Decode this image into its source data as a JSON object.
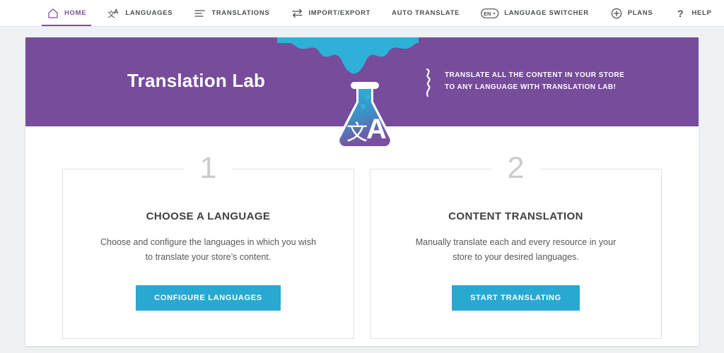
{
  "nav": {
    "items": [
      {
        "label": "HOME",
        "icon": "home-icon",
        "active": true
      },
      {
        "label": "LANGUAGES",
        "icon": "translate-icon",
        "active": false
      },
      {
        "label": "TRANSLATIONS",
        "icon": "list-lines-icon",
        "active": false
      },
      {
        "label": "IMPORT/EXPORT",
        "icon": "exchange-arrows-icon",
        "active": false
      },
      {
        "label": "AUTO TRANSLATE",
        "icon": "none",
        "active": false
      },
      {
        "label": "LANGUAGE SWITCHER",
        "icon": "en-dropdown-badge-icon",
        "active": false
      },
      {
        "label": "PLANS",
        "icon": "plus-circle-icon",
        "active": false
      },
      {
        "label": "HELP",
        "icon": "question-mark-icon",
        "active": false
      }
    ],
    "badge_text": "EN"
  },
  "banner": {
    "title": "Translation Lab",
    "tagline_line1": "TRANSLATE ALL THE CONTENT IN YOUR STORE",
    "tagline_line2": "TO ANY LANGUAGE WITH TRANSLATION LAB!",
    "flask_glyph_cjk": "文",
    "flask_glyph_latin": "A"
  },
  "cards": [
    {
      "number": "1",
      "title": "CHOOSE A LANGUAGE",
      "description": "Choose and configure the languages in which you wish to translate your store’s content.",
      "button_label": "CONFIGURE LANGUAGES"
    },
    {
      "number": "2",
      "title": "CONTENT TRANSLATION",
      "description": "Manually translate each and every resource in your store to your desired languages.",
      "button_label": "START TRANSLATING"
    }
  ],
  "colors": {
    "purple": "#764c9b",
    "cyan": "#29a9d0",
    "page_bg": "#eef2f5",
    "nav_text": "#4a4f56",
    "card_number": "#c9cccf"
  }
}
